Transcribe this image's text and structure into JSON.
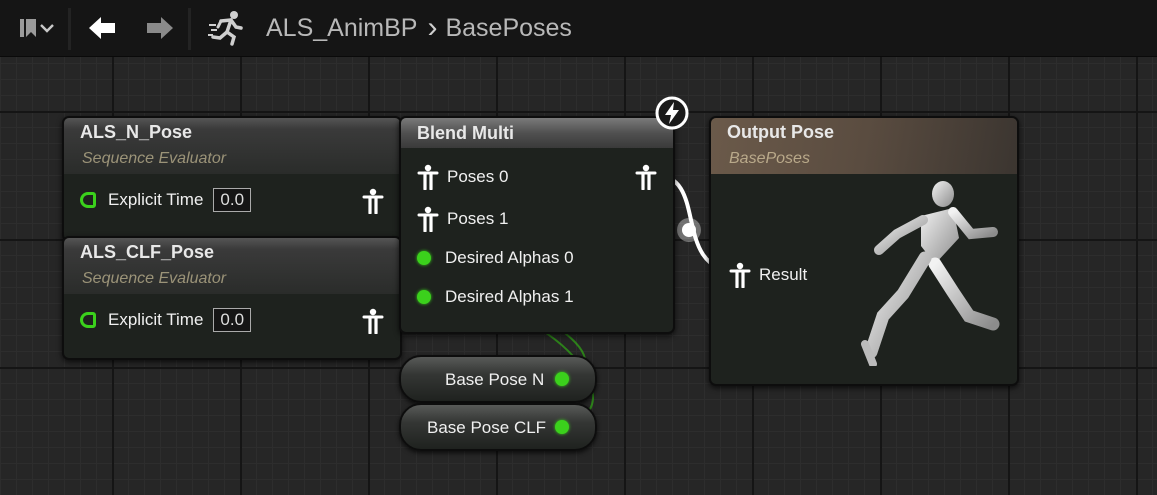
{
  "breadcrumb": {
    "parent": "ALS_AnimBP",
    "separator": "›",
    "current": "BasePoses"
  },
  "toolbar": {
    "bookmark_icon": "bookmark-icon",
    "back_icon": "arrow-left-icon",
    "forward_icon": "arrow-right-icon",
    "graph_icon": "running-man-icon"
  },
  "nodes": {
    "als_n_pose": {
      "title": "ALS_N_Pose",
      "subtitle": "Sequence Evaluator",
      "time_label": "Explicit Time",
      "time_value": "0.0"
    },
    "als_clf_pose": {
      "title": "ALS_CLF_Pose",
      "subtitle": "Sequence Evaluator",
      "time_label": "Explicit Time",
      "time_value": "0.0"
    },
    "blend_multi": {
      "title": "Blend Multi",
      "pins": [
        "Poses 0",
        "Poses 1",
        "Desired Alphas 0",
        "Desired Alphas 1"
      ]
    },
    "output_pose": {
      "title": "Output Pose",
      "subtitle": "BasePoses",
      "pin_label": "Result"
    },
    "base_pose_n": {
      "label": "Base Pose N"
    },
    "base_pose_clf": {
      "label": "Base Pose CLF"
    }
  },
  "colors": {
    "float_pin": "#3bd11c",
    "pose_pin": "#ffffff",
    "graph_bg": "#262626",
    "toolbar_bg": "#151515"
  }
}
